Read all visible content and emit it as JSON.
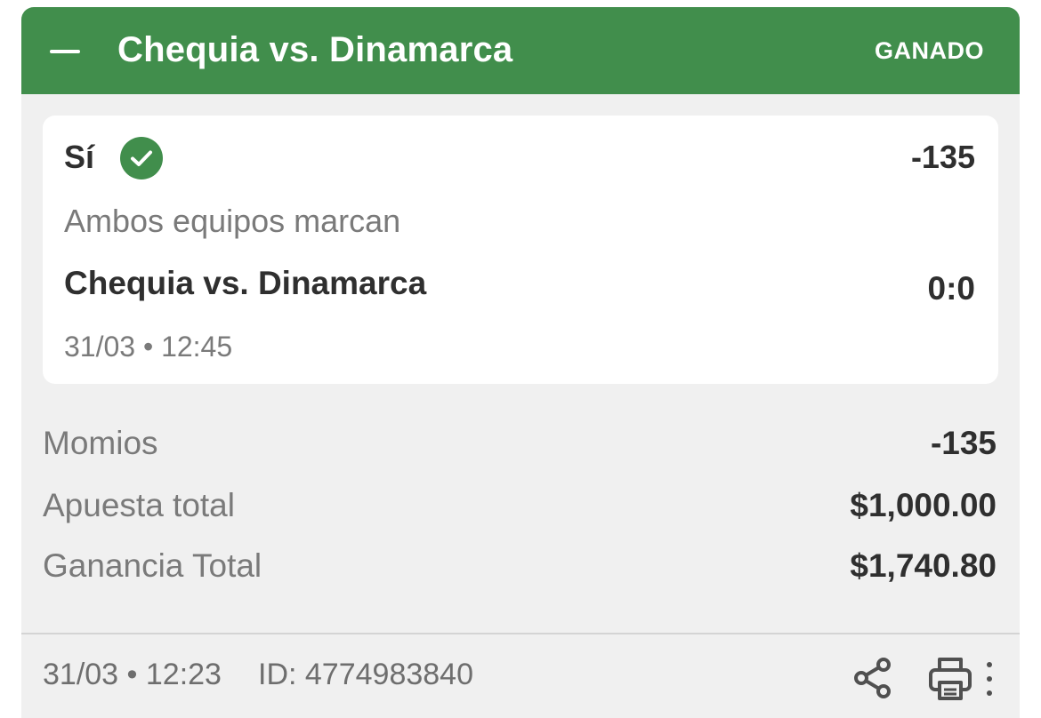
{
  "header": {
    "title": "Chequia vs. Dinamarca",
    "status": "GANADO",
    "color": "#418e4c",
    "collapse_icon": "minus-icon"
  },
  "selection": {
    "label": "Sí",
    "status_icon": "check-circle-icon",
    "odds": "-135",
    "market": "Ambos equipos marcan",
    "event": "Chequia vs. Dinamarca",
    "score": "0:0",
    "datetime": "31/03 • 12:45"
  },
  "summary": [
    {
      "label": "Momios",
      "value": "-135"
    },
    {
      "label": "Apuesta total",
      "value": "$1,000.00"
    },
    {
      "label": "Ganancia Total",
      "value": "$1,740.80"
    }
  ],
  "footer": {
    "datetime": "31/03 • 12:23",
    "id": "ID: 4774983840",
    "icons": [
      "share-icon",
      "print-icon",
      "more-vertical-icon"
    ]
  }
}
